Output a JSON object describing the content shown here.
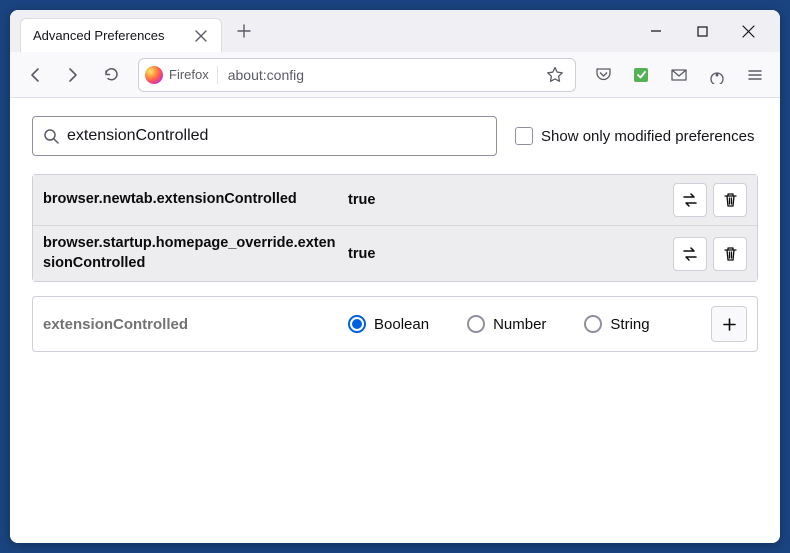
{
  "window": {
    "tab_title": "Advanced Preferences"
  },
  "toolbar": {
    "identity_label": "Firefox",
    "url": "about:config"
  },
  "search": {
    "value": "extensionControlled",
    "checkbox_label": "Show only modified preferences"
  },
  "prefs": [
    {
      "name": "browser.newtab.extensionControlled",
      "value": "true"
    },
    {
      "name": "browser.startup.homepage_override.extensionControlled",
      "value": "true"
    }
  ],
  "add": {
    "name": "extensionControlled",
    "types": [
      "Boolean",
      "Number",
      "String"
    ],
    "selected": "Boolean"
  }
}
